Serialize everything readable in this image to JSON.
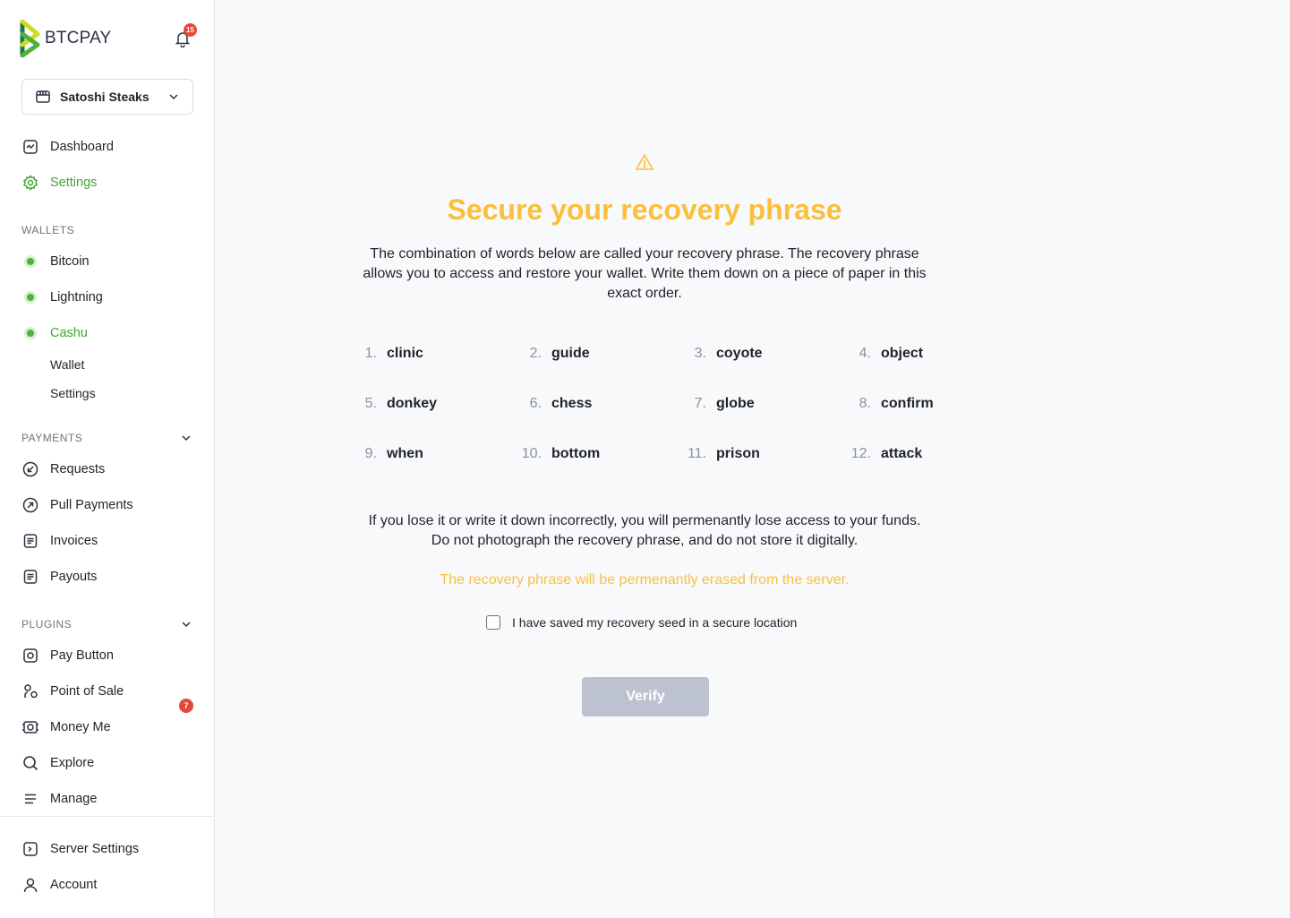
{
  "app": {
    "logo_text": "BTCPAY",
    "notification_count": "15"
  },
  "store": {
    "name": "Satoshi Steaks"
  },
  "sidebar": {
    "top_items": [
      {
        "label": "Dashboard"
      },
      {
        "label": "Settings"
      }
    ],
    "wallets_header": "WALLETS",
    "wallets": [
      {
        "label": "Bitcoin"
      },
      {
        "label": "Lightning"
      },
      {
        "label": "Cashu"
      }
    ],
    "cashu_sub": [
      {
        "label": "Wallet"
      },
      {
        "label": "Settings"
      }
    ],
    "payments_header": "PAYMENTS",
    "payments": [
      {
        "label": "Requests"
      },
      {
        "label": "Pull Payments"
      },
      {
        "label": "Invoices"
      },
      {
        "label": "Payouts"
      }
    ],
    "plugins_header": "PLUGINS",
    "plugins": [
      {
        "label": "Pay Button"
      },
      {
        "label": "Point of Sale"
      },
      {
        "label": "Money Me"
      },
      {
        "label": "Explore"
      },
      {
        "label": "Manage"
      }
    ],
    "plugins_badge": "7",
    "bottom": [
      {
        "label": "Server Settings"
      },
      {
        "label": "Account"
      }
    ]
  },
  "main": {
    "title": "Secure your recovery phrase",
    "intro": "The combination of words below are called your recovery phrase. The recovery phrase allows you to access and restore your wallet. Write them down on a piece of paper in this exact order.",
    "words": [
      {
        "num": "1.",
        "word": "clinic"
      },
      {
        "num": "2.",
        "word": "guide"
      },
      {
        "num": "3.",
        "word": "coyote"
      },
      {
        "num": "4.",
        "word": "object"
      },
      {
        "num": "5.",
        "word": "donkey"
      },
      {
        "num": "6.",
        "word": "chess"
      },
      {
        "num": "7.",
        "word": "globe"
      },
      {
        "num": "8.",
        "word": "confirm"
      },
      {
        "num": "9.",
        "word": "when"
      },
      {
        "num": "10.",
        "word": "bottom"
      },
      {
        "num": "11.",
        "word": "prison"
      },
      {
        "num": "12.",
        "word": "attack"
      }
    ],
    "warning_line1": "If you lose it or write it down incorrectly, you will permenantly lose access to your funds.",
    "warning_line2": "Do not photograph the recovery phrase, and do not store it digitally.",
    "erase_notice": "The recovery phrase will be permenantly erased from the server.",
    "checkbox_label": "I have saved my recovery seed in a secure location",
    "verify_label": "Verify"
  },
  "colors": {
    "accent_green": "#44a431",
    "warning_yellow": "#fbbf3c",
    "badge_red": "#e5483d",
    "disabled_button": "#bcc2cf"
  }
}
